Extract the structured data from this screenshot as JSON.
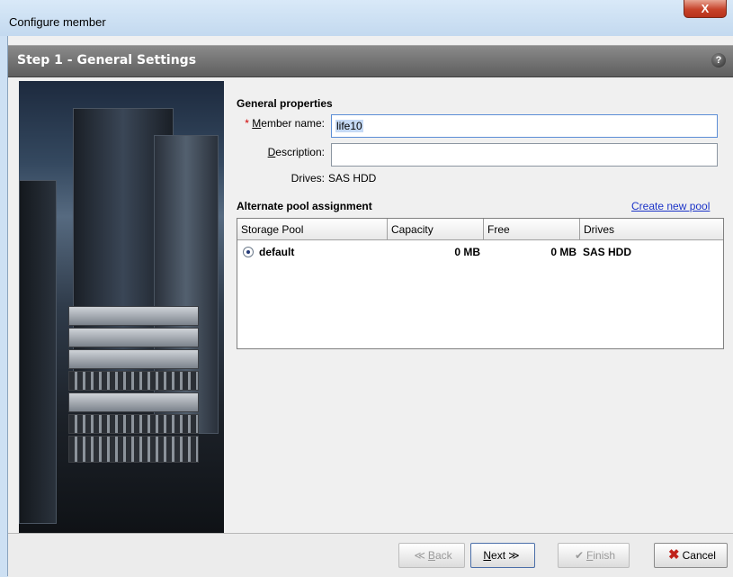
{
  "window": {
    "title": "Configure member",
    "close_label": "X"
  },
  "step": {
    "title": "Step 1 - General Settings",
    "help_label": "?"
  },
  "general": {
    "heading": "General properties",
    "required_mark": "*",
    "member_label_underline": "M",
    "member_label_rest": "ember name:",
    "member_value": "life10",
    "description_label_underline": "D",
    "description_label_rest": "escription:",
    "description_value": "",
    "drives_label": "Drives:",
    "drives_value": "SAS HDD"
  },
  "pool": {
    "heading": "Alternate pool assignment",
    "create_link": "Create new pool",
    "columns": [
      "Storage Pool",
      "Capacity",
      "Free",
      "Drives"
    ],
    "rows": [
      {
        "selected": true,
        "name": "default",
        "capacity": "0 MB",
        "free": "0 MB",
        "drives": "SAS HDD"
      }
    ]
  },
  "buttons": {
    "back_icon": "≪",
    "back_u": "B",
    "back_rest": "ack",
    "next_u": "N",
    "next_rest": "ext",
    "next_icon": "≫",
    "finish_icon": "✔",
    "finish_u": "F",
    "finish_rest": "inish",
    "cancel_icon": "✖",
    "cancel_label": "Cancel"
  }
}
